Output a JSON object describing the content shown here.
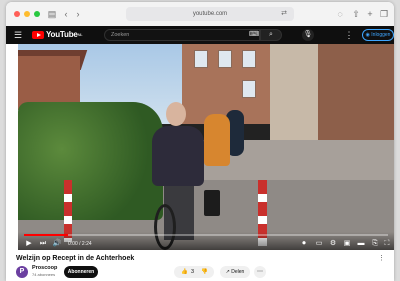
{
  "browser": {
    "url": "youtube.com",
    "traffic_lights": [
      "#ff5f57",
      "#febc2e",
      "#28c840"
    ]
  },
  "youtube_header": {
    "logo_text": "YouTube",
    "logo_suffix": "NL",
    "search_placeholder": "Zoeken",
    "sign_in_label": "Inloggen"
  },
  "player": {
    "time": "0:00 / 2:24",
    "progress": 0.12
  },
  "video": {
    "title": "Welzijn op Recept in de Achterhoek",
    "channel": {
      "avatar_letter": "P",
      "name": "Proscoop",
      "subscribers": "74 abonnees"
    },
    "subscribe_label": "Abonneren",
    "like_count": "3",
    "share_label": "Delen"
  }
}
